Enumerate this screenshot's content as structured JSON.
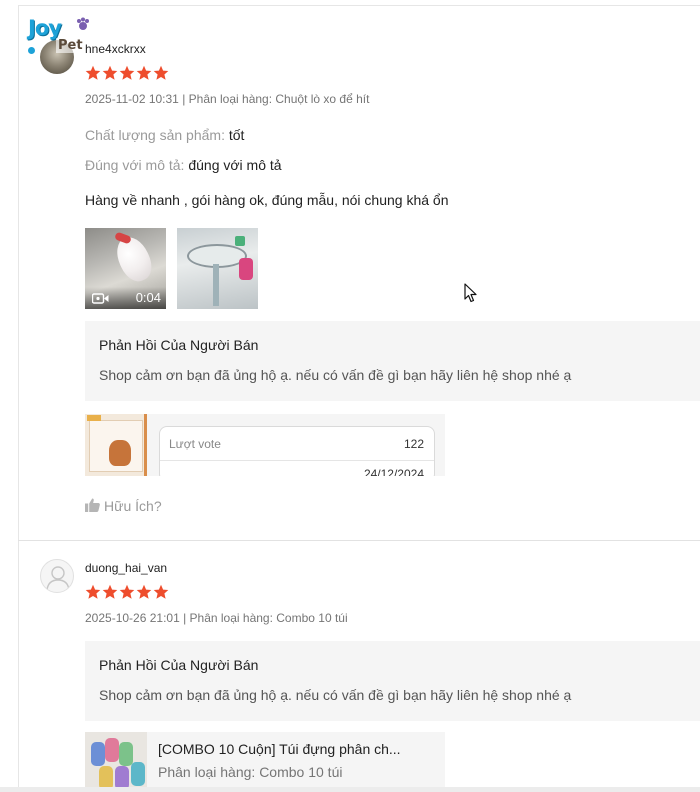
{
  "colors": {
    "star": "#ee4d2d",
    "reply_bg": "#f5f5f5",
    "muted": "#757575"
  },
  "reviews": [
    {
      "avatar": "user-photo-avatar",
      "logo": {
        "text_1": "Joy",
        "text_2": "Pet"
      },
      "username": "hne4xckrxx",
      "rating": 5,
      "meta": "2025-11-02 10:31 | Phân loại hàng: Chuột lò xo để hít",
      "attributes": [
        {
          "label": "Chất lượng sản phẩm:",
          "value": "tốt"
        },
        {
          "label": "Đúng với mô tả:",
          "value": "đúng với mô tả"
        }
      ],
      "comment": "Hàng về nhanh , gói hàng ok, đúng mẫu, nói chung khá ổn",
      "media": [
        {
          "type": "video",
          "icon": "video-camera-icon",
          "duration": "0:04"
        },
        {
          "type": "image"
        }
      ],
      "seller_reply": {
        "title": "Phản Hồi Của Người Bán",
        "text": "Shop cảm ơn bạn đã ủng hộ ạ. nếu có vấn đề gì bạn hãy liên hệ shop nhé ạ"
      },
      "vote_card": {
        "label": "Lượt vote",
        "count": "122",
        "date": "24/12/2024"
      },
      "helpful_label": "Hữu Ích?"
    },
    {
      "avatar": "default-user-avatar",
      "username": "duong_hai_van",
      "rating": 5,
      "meta": "2025-10-26 21:01 | Phân loại hàng: Combo 10 túi",
      "seller_reply": {
        "title": "Phản Hồi Của Người Bán",
        "text": "Shop cảm ơn bạn đã ủng hộ ạ. nếu có vấn đề gì bạn hãy liên hệ shop nhé ạ"
      },
      "product": {
        "name": "[COMBO 10 Cuộn] Túi đựng phân ch...",
        "variant": "Phân loại hàng: Combo 10 túi"
      }
    }
  ]
}
